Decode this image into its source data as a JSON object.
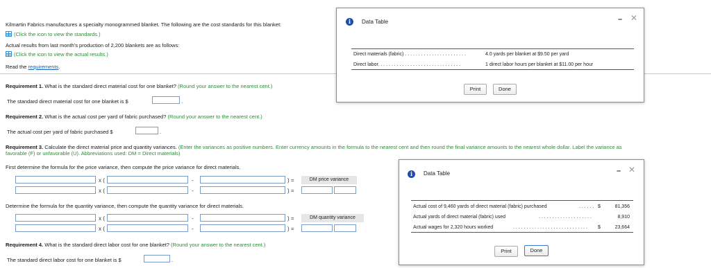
{
  "intro": {
    "text": "Kilmartin Fabrics manufactures a specialty monogrammed blanket. The following are the cost standards for this blanket:",
    "standards_link": "(Click the icon to view the standards.)",
    "actual_text": "Actual results from last month's production of 2,200 blankets are as follows:",
    "actual_link": "(Click the icon to view the actual results.)",
    "read_prefix": "Read the ",
    "read_link": "requirements",
    "read_suffix": "."
  },
  "req1": {
    "label": "Requirement 1.",
    "question": " What is the standard direct material cost for one blanket? ",
    "hint": "(Round your answer to the nearest cent.)",
    "answer_prefix": "The standard direct material cost for one blanket is $",
    "answer_suffix": "."
  },
  "req2": {
    "label": "Requirement 2.",
    "question": " What is the actual cost per yard of fabric purchased? ",
    "hint": "(Round your answer to the nearest cent.)",
    "answer_prefix": "The actual cost per yard of fabric purchased $",
    "answer_suffix": "."
  },
  "req3": {
    "label": "Requirement 3.",
    "question": " Calculate the direct material price and quantity variances. ",
    "hint_line1": "(Enter the variances as positive numbers. Enter currency amounts in the formula to the nearest cent and then round the final variance amounts to the nearest whole dollar. Label the variance as",
    "hint_line2": "favorable (F) or unfavorable (U). Abbreviations used: DM = Direct materials)",
    "price_intro": "First determine the formula for the price variance, then compute the price variance for direct materials.",
    "price_label": "DM price variance",
    "qty_intro": "Determine the formula for the quantity variance, then compute the quantity variance for direct materials.",
    "qty_label": "DM quantity variance",
    "times": "x (",
    "minus": "-",
    "close_eq": ") =",
    "eq": "="
  },
  "req4": {
    "label": "Requirement 4.",
    "question": " What is the standard direct labor cost for one blanket? ",
    "hint": "(Round your answer to the nearest cent.)",
    "answer_prefix": "The standard direct labor cost for one blanket is $",
    "answer_suffix": "."
  },
  "popup_standards": {
    "title": "Data Table",
    "rows": [
      {
        "label": "Direct materials (fabric)",
        "dots": " . . . . . . . . . . . . . . . . . . . . . . .",
        "value": "4.0 yards per blanket at $9.50 per yard"
      },
      {
        "label": "Direct labor",
        "dots": ". . . . . . . . . . . . . . . . . . . . . . . . . . . . . . .",
        "value": "1 direct labor hours per blanket at $11.00 per hour"
      }
    ],
    "print": "Print",
    "done": "Done"
  },
  "popup_actual": {
    "title": "Data Table",
    "rows": [
      {
        "label": "Actual cost of 9,460 yards of direct material (fabric) purchased",
        "dots": ". . . . . .",
        "currency": "$",
        "value": "81,356"
      },
      {
        "label": "Actual yards of direct material (fabric) used",
        "dots": ". . . . . . . . . . . . . . . . . . . .",
        "currency": "",
        "value": "8,910"
      },
      {
        "label": "Actual wages for 2,320 hours worked",
        "dots": ". . . . . . . . . . . . . . . . . . . . . . . . . . . .",
        "currency": "$",
        "value": "23,664"
      }
    ],
    "print": "Print",
    "done": "Done"
  },
  "icons": {
    "info": "i",
    "minimize": "–",
    "close": "✕"
  }
}
